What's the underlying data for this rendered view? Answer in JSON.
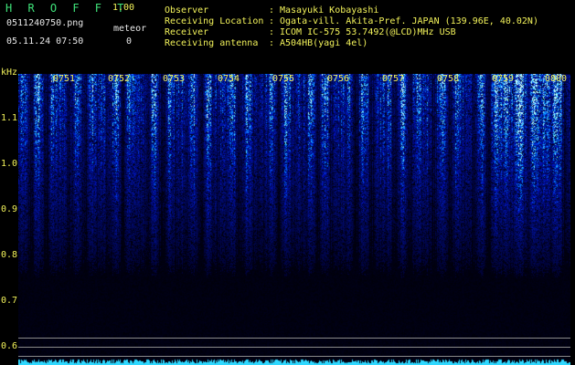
{
  "header": {
    "app_title": "H R O F F T",
    "version": "1.00",
    "filename": "0511240750.png",
    "meteor_label": "meteor",
    "meteor_count": "0",
    "datetime": "05.11.24 07:50"
  },
  "info": [
    {
      "label": "Observer",
      "value": "Masayuki Kobayashi"
    },
    {
      "label": "Receiving Location",
      "value": "Ogata-vill. Akita-Pref. JAPAN (139.96E, 40.02N)"
    },
    {
      "label": "Receiver",
      "value": "ICOM IC-575 53.7492(@LCD)MHz USB"
    },
    {
      "label": "Receiving antenna",
      "value": "A504HB(yagi 4el)"
    }
  ],
  "separator": ":",
  "axis": {
    "unit": "kHz",
    "ticks": [
      "1.1",
      "1.0",
      "0.9",
      "0.8",
      "0.7",
      "0.6"
    ]
  },
  "times": [
    "0751",
    "0752",
    "0753",
    "0754",
    "0755",
    "0756",
    "0757",
    "0758",
    "0759",
    "0800"
  ],
  "colors": {
    "background": "#000000",
    "label_yellow": "#f2f25a",
    "title_green": "#3fe37a",
    "spectrum_blue": "#1a3cff",
    "baseline_cyan": "#2fd8ff"
  }
}
